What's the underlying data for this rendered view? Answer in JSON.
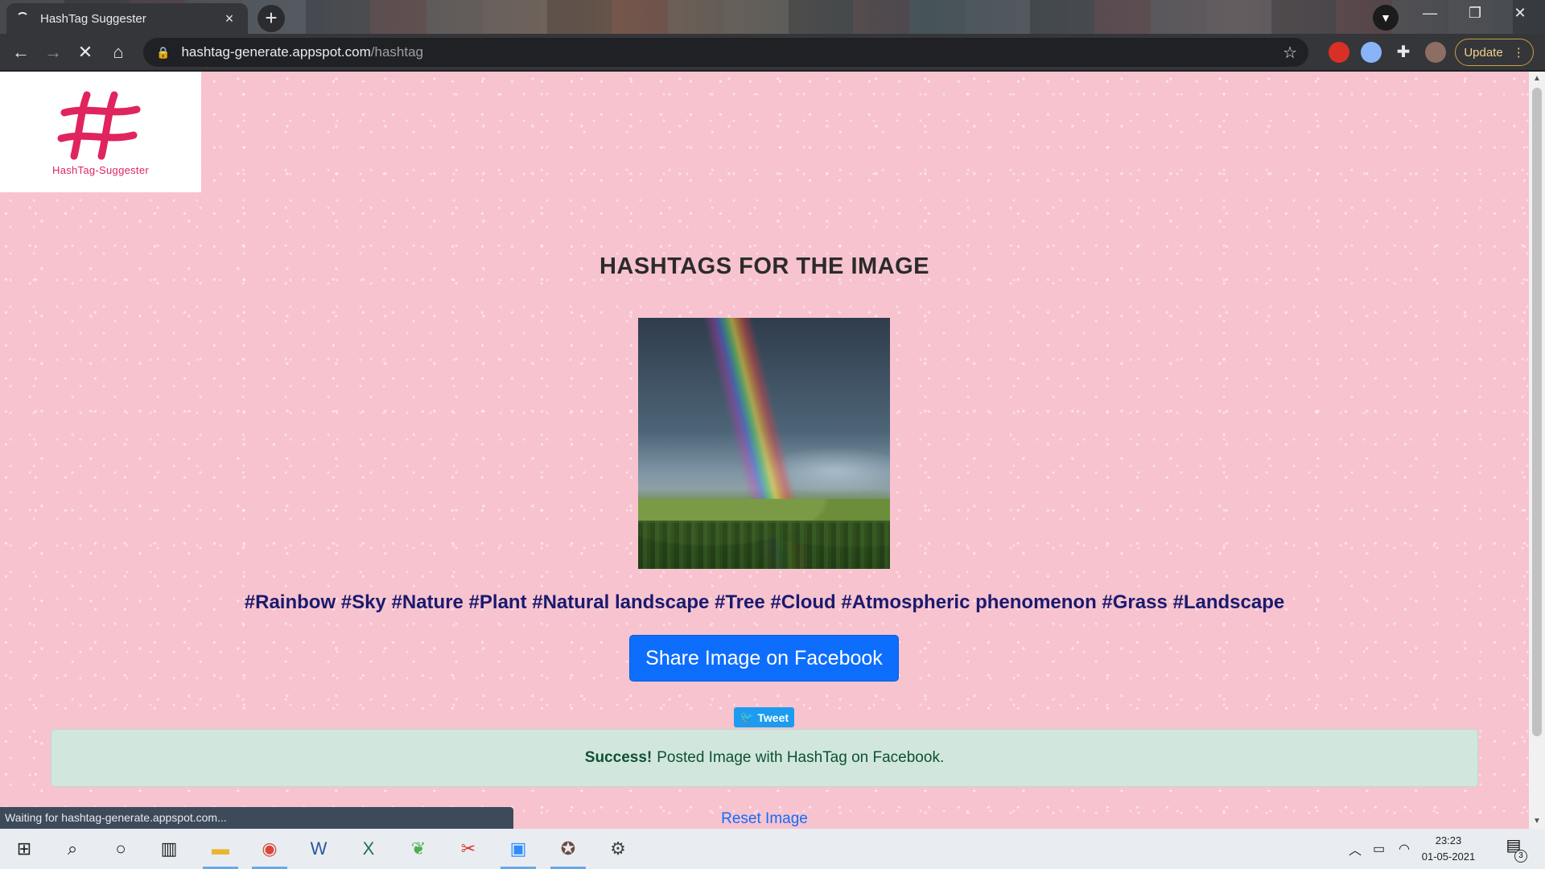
{
  "browser": {
    "tab_title": "HashTag Suggester",
    "tab_close": "×",
    "new_tab": "+",
    "url_host": "hashtag-generate.appspot.com",
    "url_path": "/hashtag",
    "update_label": "Update",
    "status_text": "Waiting for hashtag-generate.appspot.com..."
  },
  "page": {
    "logo_text": "HashTag-Suggester",
    "heading": "HASHTAGS FOR THE IMAGE",
    "hashtags": "#Rainbow #Sky #Nature #Plant #Natural landscape #Tree #Cloud #Atmospheric phenomenon #Grass #Landscape",
    "facebook_button": "Share Image on Facebook",
    "tweet_button": "Tweet",
    "alert_strong": "Success!",
    "alert_text": "Posted Image with HashTag on Facebook.",
    "reset_link": "Reset Image"
  },
  "taskbar": {
    "time": "23:23",
    "date": "01-05-2021",
    "notification_count": "3"
  },
  "colors": {
    "page_background": "#f7c3cf",
    "heading": "#2b2b2b",
    "hashtags": "#1a1a6e",
    "primary_button": "#0d6efd",
    "twitter": "#1d9bf0",
    "alert_background": "#d1e7dd",
    "alert_text": "#0f5132",
    "logo": "#e0245e"
  }
}
